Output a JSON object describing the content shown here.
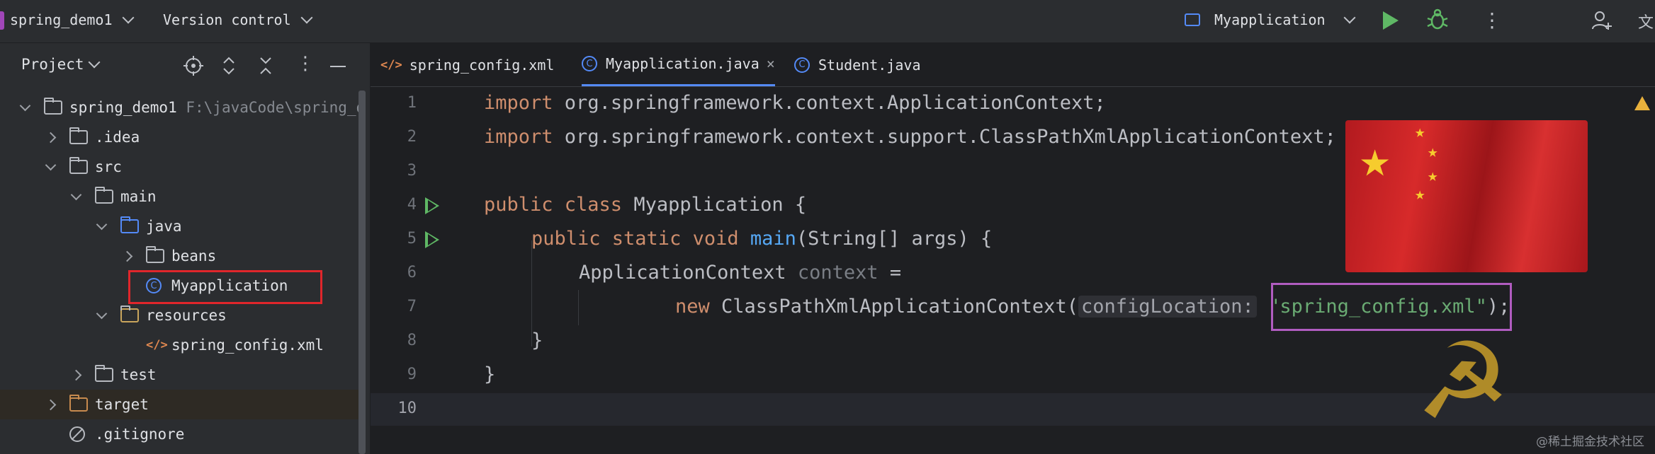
{
  "topbar": {
    "project_name": "spring_demo1",
    "vcs_label": "Version control",
    "run_config": "Myapplication"
  },
  "sidebar": {
    "title": "Project",
    "tree": [
      {
        "label": "spring_demo1",
        "path": "F:\\javaCode\\spring_d"
      },
      {
        "label": ".idea"
      },
      {
        "label": "src"
      },
      {
        "label": "main"
      },
      {
        "label": "java"
      },
      {
        "label": "beans"
      },
      {
        "label": "Myapplication"
      },
      {
        "label": "resources"
      },
      {
        "label": "spring_config.xml"
      },
      {
        "label": "test"
      },
      {
        "label": "target"
      },
      {
        "label": ".gitignore"
      }
    ]
  },
  "tabs": [
    {
      "label": "spring_config.xml",
      "icon": "xml-icon"
    },
    {
      "label": "Myapplication.java",
      "icon": "class-icon",
      "active": true
    },
    {
      "label": "Student.java",
      "icon": "class-icon"
    }
  ],
  "editor": {
    "line_numbers": [
      "1",
      "2",
      "3",
      "4",
      "5",
      "6",
      "7",
      "8",
      "9",
      "10"
    ],
    "code": {
      "l1_kw": "import",
      "l1_rest": " org.springframework.context.ApplicationContext;",
      "l2_kw": "import",
      "l2_rest": " org.springframework.context.support.ClassPathXmlApplicationContext;",
      "l4_kw": "public class",
      "l4_rest": " Myapplication {",
      "l5_kw": "public static void",
      "l5_fn": "main",
      "l5_rest": "(String[] args) {",
      "l6_type": "ApplicationContext",
      "l6_var": "context",
      "l6_eq": " =",
      "l7_kw": "new",
      "l7_cls": " ClassPathXmlApplicationContext(",
      "l7_hint": "configLocation:",
      "l7_str": "\"spring_config.xml\"",
      "l7_end": ");",
      "l8": "}",
      "l9": "}"
    }
  },
  "watermark": "@稀土掘金技术社区",
  "colors": {
    "keyword": "#cf8e6d",
    "function": "#56a8f5",
    "string": "#6aab73",
    "highlight_red": "#e0262b",
    "highlight_purple": "#b05cc0"
  }
}
